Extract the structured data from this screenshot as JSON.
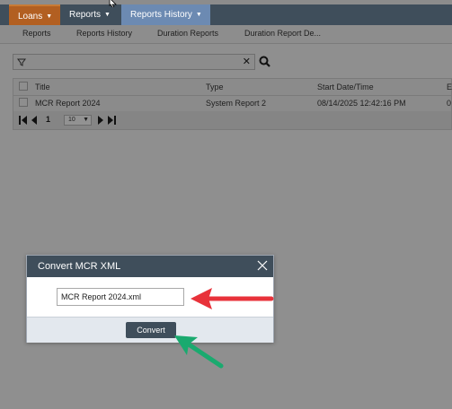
{
  "nav": {
    "tabs": [
      {
        "label": "Loans"
      },
      {
        "label": "Reports"
      },
      {
        "label": "Reports History"
      }
    ]
  },
  "subnav": {
    "items": [
      "Reports",
      "Reports History",
      "Duration Reports",
      "Duration Report De..."
    ]
  },
  "search": {
    "value": "",
    "placeholder": ""
  },
  "grid": {
    "headers": [
      "Title",
      "Type",
      "Start Date/Time",
      "E"
    ],
    "rows": [
      {
        "title": "MCR Report 2024",
        "type": "System Report 2",
        "start": "08/14/2025 12:42:16 PM",
        "extra": "0"
      }
    ],
    "pager": {
      "page": "1",
      "page_size": "10"
    }
  },
  "dialog": {
    "title": "Convert MCR XML",
    "filename": "MCR Report 2024.xml",
    "button_label": "Convert"
  },
  "annotations": {
    "red_arrow_color": "#e8323a",
    "green_arrow_color": "#1aaa6f"
  },
  "colors": {
    "nav_bg": "#3f4e5b",
    "loans_tab": "#b25f21",
    "active_tab": "#6c8ab2",
    "overlay": "#8f8f8f"
  }
}
